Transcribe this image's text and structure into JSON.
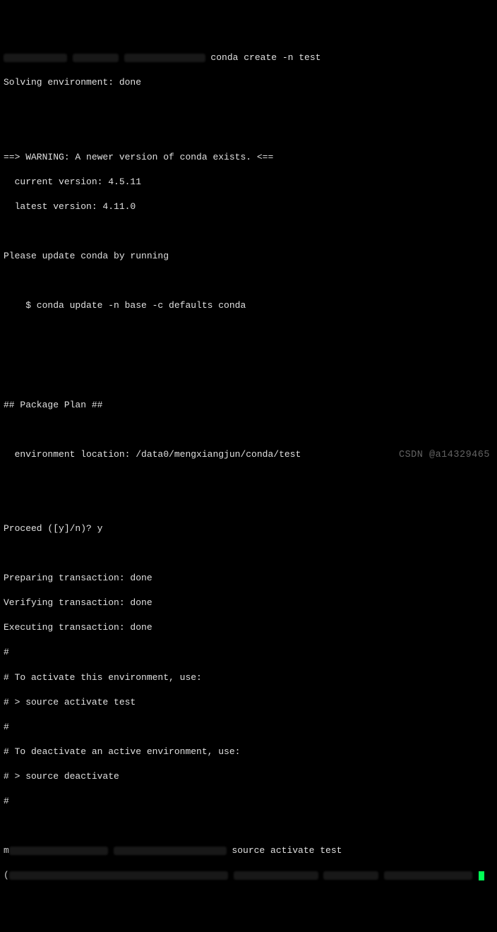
{
  "prompt_cmd1": " conda create -n test",
  "solving_env": "Solving environment: done",
  "warning_line": "==> WARNING: A newer version of conda exists. <==",
  "version_current": "  current version: 4.5.11",
  "version_latest": "  latest version: 4.11.0",
  "please_update": "Please update conda by running",
  "update_cmd": "    $ conda update -n base -c defaults conda",
  "package_plan_header": "## Package Plan ##",
  "env_location": "  environment location: /data0/mengxiangjun/conda/test",
  "proceed": "Proceed ([y]/n)? y",
  "preparing": "Preparing transaction: done",
  "verifying": "Verifying transaction: done",
  "executing": "Executing transaction: done",
  "hash_activate_use": "# To activate this environment, use:",
  "hash_source_activate": "# > source activate test",
  "hash_deactivate_use": "# To deactivate an active environment, use:",
  "hash_source_deactivate": "# > source deactivate",
  "hash_only": "#",
  "prefix_char": "m",
  "open_paren": "(",
  "prompt_cmd2": " source activate test",
  "watermark_text": "CSDN @a14329465"
}
